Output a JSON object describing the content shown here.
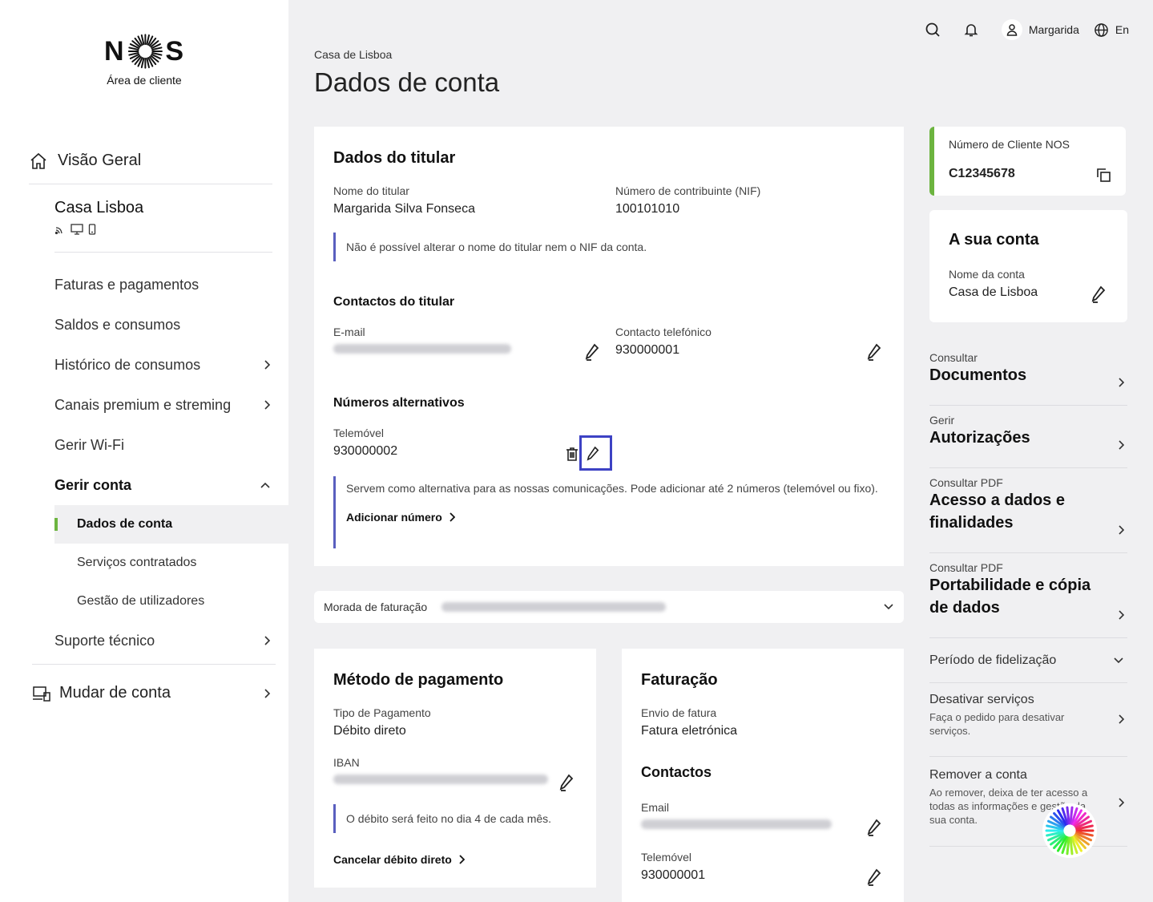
{
  "brand": {
    "logo_text_left": "N",
    "logo_text_right": "S",
    "subtitle": "Área de cliente",
    "accent": "#6cb43f",
    "note_color": "#5a5fbf"
  },
  "sidebar": {
    "overview": "Visão Geral",
    "account_name": "Casa Lisboa",
    "menu": [
      {
        "label": "Faturas e pagamentos"
      },
      {
        "label": "Saldos e consumos"
      },
      {
        "label": "Histórico de consumos"
      },
      {
        "label": "Canais premium e streming"
      },
      {
        "label": "Gerir Wi-Fi"
      },
      {
        "label": "Gerir conta"
      }
    ],
    "submenu": [
      {
        "label": "Dados de conta"
      },
      {
        "label": "Serviços contratados"
      },
      {
        "label": "Gestão de utilizadores"
      }
    ],
    "support": "Suporte técnico",
    "switch_account": "Mudar de conta"
  },
  "topbar": {
    "user": "Margarida",
    "lang": "En"
  },
  "breadcrumb": "Casa de Lisboa",
  "page_title": "Dados de conta",
  "holder": {
    "title": "Dados do titular",
    "name_label": "Nome do titular",
    "name": "Margarida Silva Fonseca",
    "nif_label": "Número de contribuinte (NIF)",
    "nif": "100101010",
    "note": "Não é possível alterar o nome do titular nem o NIF da conta.",
    "contacts_title": "Contactos do titular",
    "email_label": "E-mail",
    "phone_label": "Contacto telefónico",
    "phone": "930000001",
    "alt_title": "Números alternativos",
    "mobile_label": "Telemóvel",
    "mobile": "930000002",
    "alt_note": "Servem como alternativa para as nossas comunicações. Pode adicionar até 2 números (telemóvel ou fixo).",
    "add_number": "Adicionar número"
  },
  "billing_address": {
    "label": "Morada de faturação"
  },
  "payment": {
    "title": "Método de pagamento",
    "type_label": "Tipo de Pagamento",
    "type": "Débito direto",
    "iban_label": "IBAN",
    "note": "O débito será feito no dia 4 de cada mês.",
    "cancel": "Cancelar débito direto"
  },
  "invoicing": {
    "title": "Faturação",
    "send_label": "Envio de fatura",
    "send": "Fatura eletrónica",
    "contacts_title": "Contactos",
    "email_label": "Email",
    "mobile_label": "Telemóvel",
    "mobile": "930000001"
  },
  "client": {
    "label": "Número de Cliente NOS",
    "number": "C12345678"
  },
  "account": {
    "title": "A sua conta",
    "name_label": "Nome da conta",
    "name": "Casa de Lisboa"
  },
  "right_links": [
    {
      "small": "Consultar",
      "big": "Documentos"
    },
    {
      "small": "Gerir",
      "big": "Autorizações"
    },
    {
      "small": "Consultar PDF",
      "big": "Acesso a dados e finalidades"
    },
    {
      "small": "Consultar PDF",
      "big": "Portabilidade e cópia de dados"
    }
  ],
  "fidelity": "Período de fidelização",
  "deactivate": {
    "title": "Desativar serviços",
    "desc": "Faça o pedido para desativar serviços."
  },
  "remove": {
    "title": "Remover a conta",
    "desc": "Ao remover, deixa de ter acesso a todas as informações e gestão da sua conta."
  }
}
